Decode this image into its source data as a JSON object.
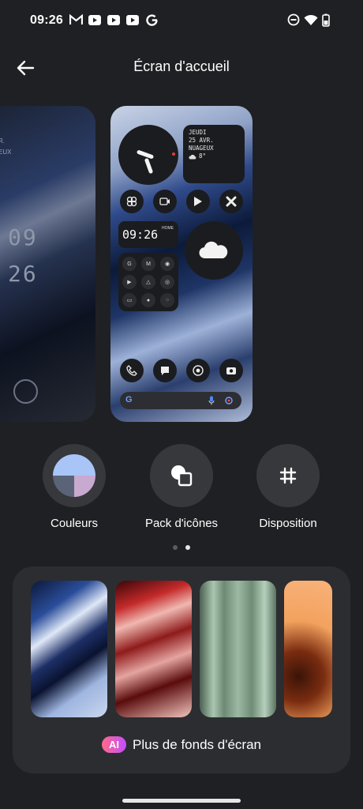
{
  "status_bar": {
    "time": "09:26"
  },
  "header": {
    "title": "Écran d'accueil"
  },
  "preview_left": {
    "small_line_1": "R.",
    "small_line_2": "EUX",
    "clock_hour": "09",
    "clock_min": "26"
  },
  "preview_main": {
    "weather_day": "JEUDI",
    "weather_date": "25 AVR.",
    "weather_cond": "NUAGEUX",
    "weather_temp": "8°",
    "digital_time": "09:26",
    "digital_label": "HOME"
  },
  "options": [
    {
      "label": "Couleurs"
    },
    {
      "label": "Pack d'icônes"
    },
    {
      "label": "Disposition"
    }
  ],
  "pagination": {
    "count": 2,
    "active": 1
  },
  "wallpapers": {
    "more_label": "Plus de fonds d'écran",
    "ai_badge": "AI"
  }
}
